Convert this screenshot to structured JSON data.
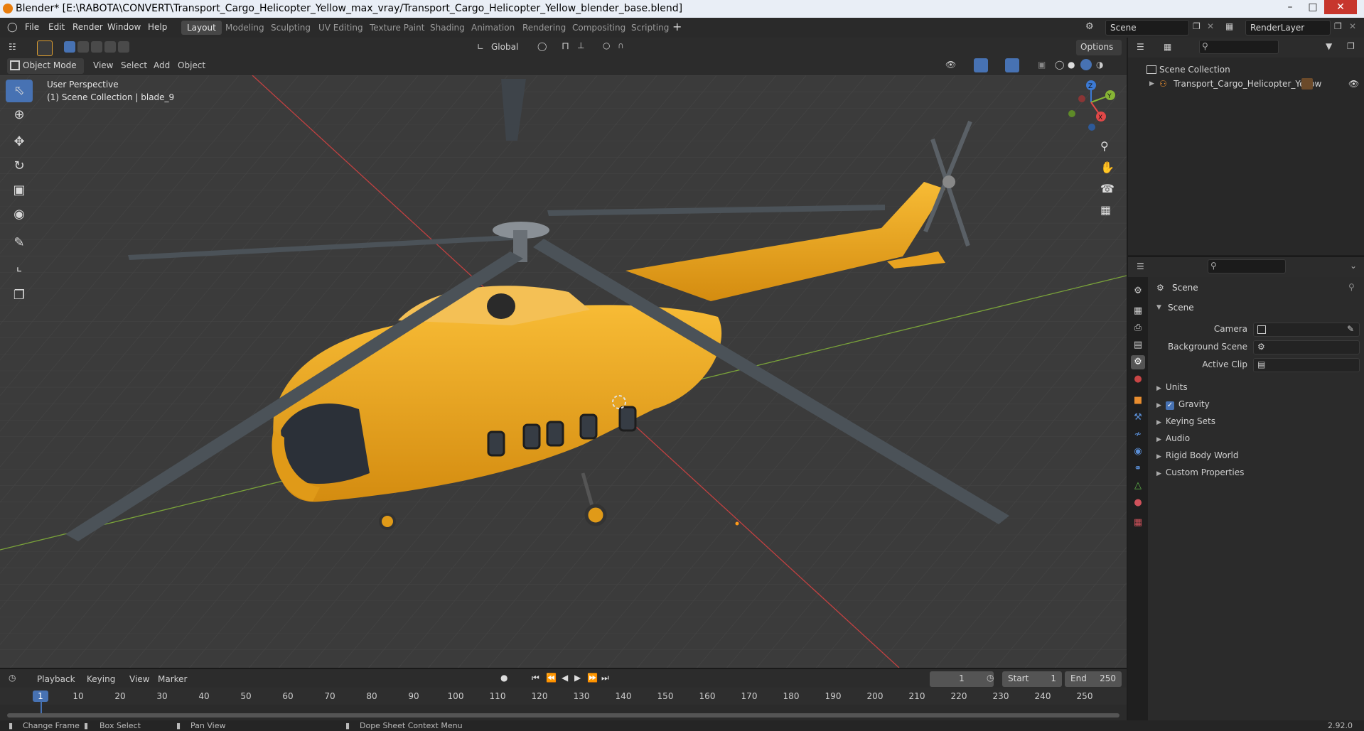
{
  "window": {
    "title": "Blender* [E:\\RABOTA\\CONVERT\\Transport_Cargo_Helicopter_Yellow_max_vray/Transport_Cargo_Helicopter_Yellow_blender_base.blend]",
    "minimize": "–",
    "maximize": "□",
    "close": "✕"
  },
  "menubar": {
    "file": "File",
    "edit": "Edit",
    "render": "Render",
    "window": "Window",
    "help": "Help"
  },
  "workspaces": [
    "Layout",
    "Modeling",
    "Sculpting",
    "UV Editing",
    "Texture Paint",
    "Shading",
    "Animation",
    "Rendering",
    "Compositing",
    "Scripting"
  ],
  "workspace_add": "+",
  "scene_selector": "Scene",
  "renderlayer_selector": "RenderLayer",
  "viewport": {
    "transform_orientation": "Global",
    "options_label": "Options",
    "mode": "Object Mode",
    "menu": {
      "view": "View",
      "select": "Select",
      "add": "Add",
      "object": "Object"
    },
    "overlay_line1": "User Perspective",
    "overlay_line2": "(1) Scene Collection | blade_9",
    "gizmo": {
      "z": "Z",
      "y": "Y",
      "x": "X"
    }
  },
  "outliner": {
    "root": "Scene Collection",
    "items": [
      {
        "label": "Transport_Cargo_Helicopter_Yellow"
      }
    ]
  },
  "properties": {
    "context": "Scene",
    "panel_title": "Scene",
    "fields": {
      "camera": "Camera",
      "background_scene": "Background Scene",
      "active_clip": "Active Clip"
    },
    "subpanels": [
      "Units",
      "Gravity",
      "Keying Sets",
      "Audio",
      "Rigid Body World",
      "Custom Properties"
    ],
    "gravity_checked": true
  },
  "timeline": {
    "menu": {
      "playback": "Playback",
      "keying": "Keying",
      "view": "View",
      "marker": "Marker"
    },
    "current_frame": "1",
    "start_label": "Start",
    "start_value": "1",
    "end_label": "End",
    "end_value": "250",
    "ticks": [
      "1",
      "10",
      "20",
      "30",
      "40",
      "50",
      "60",
      "70",
      "80",
      "90",
      "100",
      "110",
      "120",
      "130",
      "140",
      "150",
      "160",
      "170",
      "180",
      "190",
      "200",
      "210",
      "220",
      "230",
      "240",
      "250"
    ]
  },
  "statusbar": {
    "change_frame": "Change Frame",
    "box_select": "Box Select",
    "pan_view": "Pan View",
    "context_menu": "Dope Sheet Context Menu",
    "version": "2.92.0"
  },
  "colors": {
    "accent": "#4772b3",
    "helicopter": "#f0a81c",
    "axis_x": "#c24141",
    "axis_y": "#7aa33a"
  }
}
